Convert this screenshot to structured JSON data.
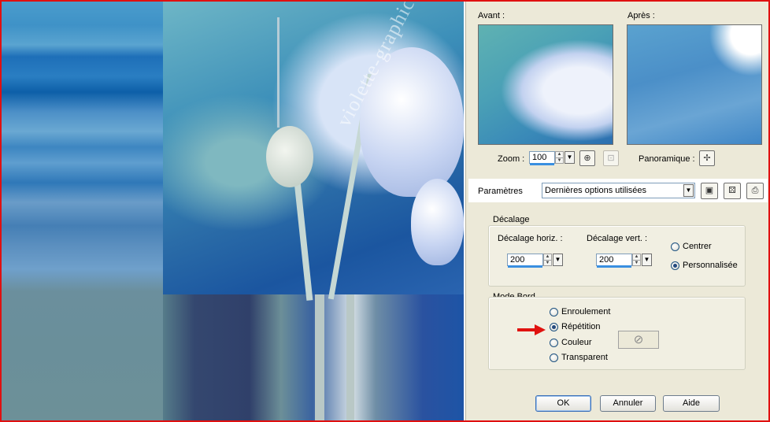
{
  "preview": {
    "before_label": "Avant :",
    "after_label": "Après :",
    "zoom_label": "Zoom :",
    "zoom_value": "100",
    "pan_label": "Panoramique :"
  },
  "presets": {
    "label": "Paramètres",
    "selected": "Dernières options utilisées"
  },
  "offset": {
    "group_title": "Décalage",
    "horiz_label": "Décalage horiz. :",
    "horiz_value": "200",
    "vert_label": "Décalage vert. :",
    "vert_value": "200",
    "center_label": "Centrer",
    "custom_label": "Personnalisée",
    "selected": "Personnalisée"
  },
  "edge_mode": {
    "group_title": "Mode Bord",
    "options": [
      "Enroulement",
      "Répétition",
      "Couleur",
      "Transparent"
    ],
    "selected": "Répétition"
  },
  "buttons": {
    "ok": "OK",
    "cancel": "Annuler",
    "help": "Aide"
  },
  "watermark": "violette-graphic",
  "colors": {
    "frame": "#e01010",
    "arrow": "#e0120f",
    "panel_bg": "#ece9d8"
  }
}
